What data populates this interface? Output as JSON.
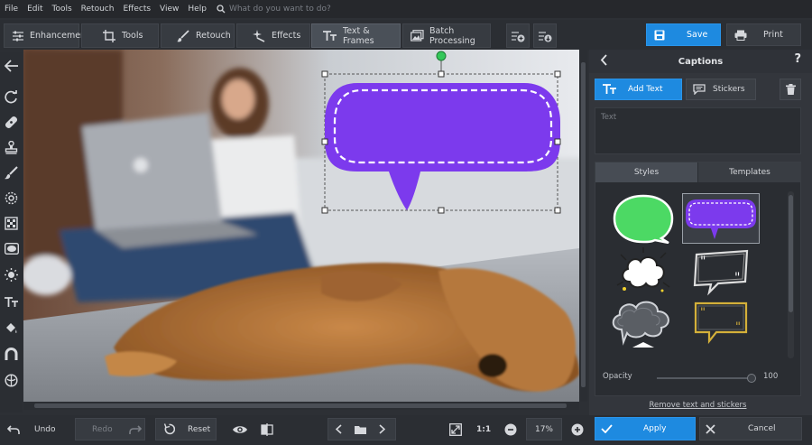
{
  "menu": {
    "items": [
      "File",
      "Edit",
      "Tools",
      "Retouch",
      "Effects",
      "View",
      "Help"
    ],
    "search_placeholder": "What do you want to do?"
  },
  "toolbar": {
    "tabs": [
      {
        "label": "Enhancement",
        "icon": "sliders-icon"
      },
      {
        "label": "Tools",
        "icon": "crop-icon"
      },
      {
        "label": "Retouch",
        "icon": "brush-icon"
      },
      {
        "label": "Effects",
        "icon": "sparkle-icon"
      },
      {
        "label": "Text & Frames",
        "icon": "text-icon",
        "active": true
      },
      {
        "label": "Batch Processing",
        "icon": "images-icon"
      }
    ],
    "save_label": "Save",
    "print_label": "Print"
  },
  "panel": {
    "title": "Captions",
    "help": "?",
    "add_text_label": "Add Text",
    "stickers_label": "Stickers",
    "text_placeholder": "Text",
    "tabs": {
      "styles": "Styles",
      "templates": "Templates"
    },
    "opacity_label": "Opacity",
    "opacity_value": "100",
    "remove_link": "Remove text and stickers"
  },
  "bottom": {
    "undo_label": "Undo",
    "redo_label": "Redo",
    "reset_label": "Reset",
    "ratio_label": "1:1",
    "zoom_value": "17%",
    "apply_label": "Apply",
    "cancel_label": "Cancel"
  },
  "colors": {
    "accent": "#1e8ae0",
    "caption_purple": "#7c3aed",
    "sticker_green": "#4cd964",
    "handle_green": "#34c759"
  }
}
